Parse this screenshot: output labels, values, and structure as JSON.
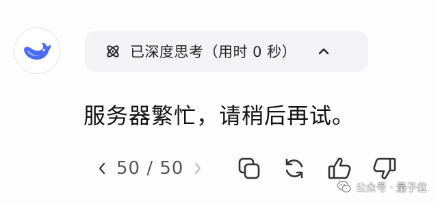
{
  "assistant": {
    "avatar_icon": "deepseek-whale-icon",
    "accent_color": "#4d6bfe"
  },
  "thinking": {
    "icon": "atom-icon",
    "label": "已深度思考（用时 0 秒）",
    "toggle_icon": "chevron-up-icon",
    "expanded": true
  },
  "message": {
    "text": "服务器繁忙，请稍后再试。"
  },
  "pagination": {
    "prev_icon": "chevron-left-icon",
    "count": "50 / 50",
    "next_icon": "chevron-right-icon"
  },
  "actions": [
    {
      "name": "copy",
      "icon": "copy-icon"
    },
    {
      "name": "regenerate",
      "icon": "refresh-icon"
    },
    {
      "name": "like",
      "icon": "thumbs-up-icon"
    },
    {
      "name": "dislike",
      "icon": "thumbs-down-icon"
    }
  ],
  "watermark": {
    "text": "公众号 · 量子位",
    "icon": "wechat-icon"
  }
}
